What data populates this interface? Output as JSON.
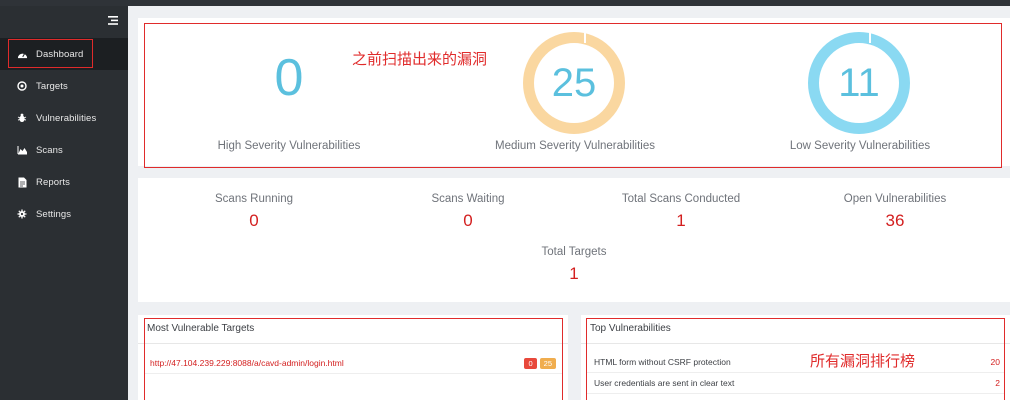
{
  "sidebar": {
    "items": [
      {
        "label": "Dashboard",
        "icon": "dashboard-icon",
        "active": true
      },
      {
        "label": "Targets",
        "icon": "target-icon"
      },
      {
        "label": "Vulnerabilities",
        "icon": "bug-icon"
      },
      {
        "label": "Scans",
        "icon": "area-chart-icon"
      },
      {
        "label": "Reports",
        "icon": "report-icon"
      },
      {
        "label": "Settings",
        "icon": "gear-icon"
      }
    ]
  },
  "severity": {
    "high": {
      "value": "0",
      "label": "High Severity Vulnerabilities"
    },
    "medium": {
      "value": "25",
      "label": "Medium Severity Vulnerabilities"
    },
    "low": {
      "value": "11",
      "label": "Low Severity Vulnerabilities"
    }
  },
  "annotations": {
    "top": "之前扫描出来的漏洞",
    "bottom": "所有漏洞排行榜"
  },
  "stats": {
    "scans_running": {
      "label": "Scans Running",
      "value": "0"
    },
    "scans_waiting": {
      "label": "Scans Waiting",
      "value": "0"
    },
    "total_scans": {
      "label": "Total Scans Conducted",
      "value": "1"
    },
    "open_vulns": {
      "label": "Open Vulnerabilities",
      "value": "36"
    },
    "total_targets": {
      "label": "Total Targets",
      "value": "1"
    }
  },
  "most_vulnerable": {
    "title": "Most Vulnerable Targets",
    "rows": [
      {
        "url": "http://47.104.239.229:8088/a/cavd-admin/login.html",
        "high": "0",
        "medium": "25"
      }
    ]
  },
  "top_vulns": {
    "title": "Top Vulnerabilities",
    "rows": [
      {
        "name": "HTML form without CSRF protection",
        "count": "20"
      },
      {
        "name": "User credentials are sent in clear text",
        "count": "2"
      }
    ]
  },
  "colors": {
    "accent_red": "#e02b2b",
    "ring_medium": "#fad7a0",
    "ring_low": "#8ad9f2",
    "number_blue": "#5bc0de"
  }
}
